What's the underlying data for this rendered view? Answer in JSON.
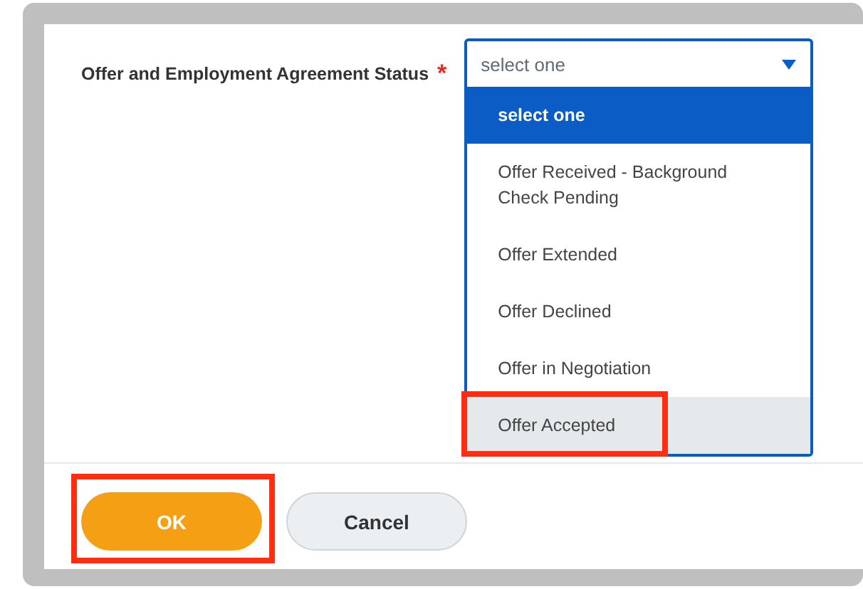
{
  "field": {
    "label": "Offer and Employment Agreement Status",
    "required_mark": "*",
    "value": "select one",
    "expanded": true
  },
  "options": [
    {
      "label": "select one",
      "selected": true,
      "hovered": false,
      "annotated": false
    },
    {
      "label": "Offer Received - Background Check Pending",
      "selected": false,
      "hovered": false,
      "annotated": false
    },
    {
      "label": "Offer Extended",
      "selected": false,
      "hovered": false,
      "annotated": false
    },
    {
      "label": "Offer Declined",
      "selected": false,
      "hovered": false,
      "annotated": false
    },
    {
      "label": "Offer in Negotiation",
      "selected": false,
      "hovered": false,
      "annotated": false
    },
    {
      "label": "Offer Accepted",
      "selected": false,
      "hovered": true,
      "annotated": true
    }
  ],
  "buttons": [
    {
      "label": "OK",
      "kind": "primary",
      "annotated": true
    },
    {
      "label": "Cancel",
      "kind": "secondary",
      "annotated": false
    }
  ]
}
